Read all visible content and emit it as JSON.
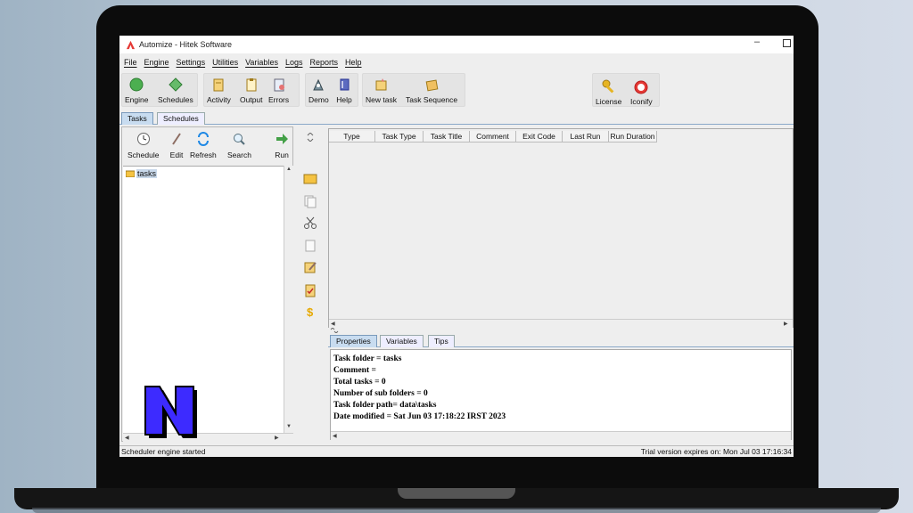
{
  "window": {
    "title": "Automize   - Hitek Software"
  },
  "menu": [
    "File",
    "Engine",
    "Settings",
    "Utilities",
    "Variables",
    "Logs",
    "Reports",
    "Help"
  ],
  "toolbar": {
    "engine": "Engine",
    "schedules": "Schedules",
    "activity": "Activity",
    "output": "Output",
    "errors": "Errors",
    "demo": "Demo",
    "help": "Help",
    "new_task": "New task",
    "task_sequence": "Task Sequence",
    "license": "License",
    "iconify": "Iconify"
  },
  "main_tabs": [
    "Tasks",
    "Schedules"
  ],
  "left_toolbar": {
    "schedule": "Schedule",
    "edit": "Edit",
    "refresh": "Refresh",
    "search": "Search",
    "run": "Run"
  },
  "tree": {
    "root": "tasks"
  },
  "table": {
    "columns": [
      "Type",
      "Task Type",
      "Task Title",
      "Comment",
      "Exit Code",
      "Last Run",
      "Run Duration"
    ]
  },
  "props_tabs": [
    "Properties",
    "Variables",
    "Tips"
  ],
  "properties": [
    "Task folder = tasks",
    "Comment =",
    "Total tasks = 0",
    "Number of sub folders = 0",
    "Task folder path= data\\tasks",
    "Date modified = Sat Jun 03 17:18:22 IRST 2023"
  ],
  "status": {
    "left": "Scheduler engine started",
    "right": "Trial version expires on: Mon Jul 03 17:16:34"
  },
  "colors": {
    "accent_tab": "#c8dcf0",
    "engine_green": "#4caf50",
    "watermark_blue": "#3d2bff"
  }
}
